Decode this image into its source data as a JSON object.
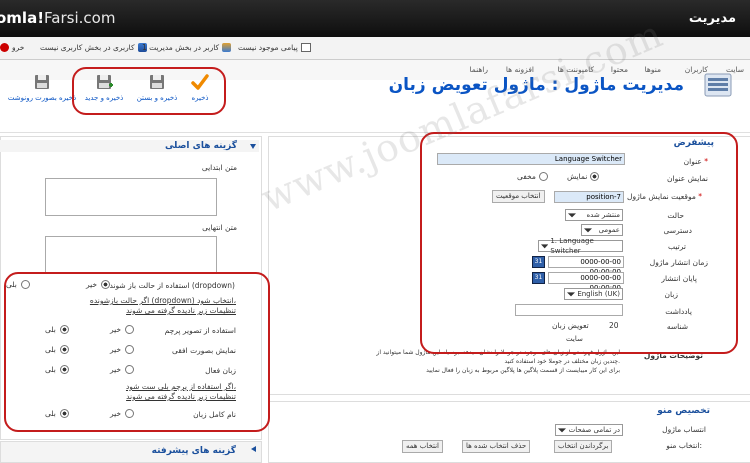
{
  "header": {
    "logo_a": "omla!",
    "logo_b": "Farsi.com",
    "title": "مدیریت"
  },
  "status": {
    "item1": "کاربری در بخش کاربری نیست",
    "item2": "1 کاربر در بخش مدیریت",
    "item3": "پیامی موجود نیست",
    "item4": "خرو"
  },
  "menu": [
    "سایت",
    "کاربران",
    "منوها",
    "محتوا",
    "کامپوننت ها",
    "افزونه ها",
    "راهنما"
  ],
  "toolbar": {
    "save": "ذخیره",
    "save_close": "ذخیره و بستن",
    "save_new": "ذخیره و جدید",
    "save_copy": "ذخیره بصورت رونوشت"
  },
  "page_title": "مدیریت ماژول : ماژول تعویض زبان",
  "details": {
    "title": "پیشفرض",
    "fields": {
      "title_label": "عنوان",
      "title_value": "Language Switcher",
      "show_title_label": "نمایش عنوان",
      "show": "نمایش",
      "hide": "مخفی",
      "position_label": "موقعیت نمایش ماژول",
      "position_value": "position-7",
      "position_btn": "انتخاب موقعیت",
      "status_label": "حالت",
      "status_value": "منتشر شده",
      "access_label": "دسترسی",
      "access_value": "عمومی",
      "order_label": "ترتیب",
      "order_value": "1. Language Switcher",
      "publish_up_label": "زمان انتشار ماژول",
      "publish_up_value": "0000-00-00 00:00:00",
      "publish_down_label": "پایان انتشار",
      "publish_down_value": "0000-00-00 00:00:00",
      "lang_label": "زبان",
      "lang_value": "English (UK)",
      "note_label": "یادداشت",
      "id_label": "شناسه",
      "id_value": "20",
      "type_value": "تعویض زبان",
      "site": "سایت"
    },
    "desc_label": "توضیحات ماژول",
    "desc_line1": "این ماژول فهرستی از زبان های موجود در جوملا را نشان میدهد. بوسیله این ماژول شما میتوانید از",
    "desc_line2": "چندین زبان مختلف در جوملا خود استفاده کنید.",
    "desc_line3": "برای این کار میبایست از قسمت پلاگین ها پلاگین مربوط به زبان را فعال نمایید"
  },
  "menu_assign": {
    "title": "تخصیص منو",
    "assign_label": "انتساب ماژول",
    "assign_value": "در تمامی صفحات",
    "select_label": "انتخاب منو:",
    "btn_invert": "برگرداندن انتخاب",
    "btn_clear": "حذف انتخاب شده ها",
    "btn_all": "انتخاب همه"
  },
  "basic": {
    "title": "گزینه های اصلی",
    "pre_text": "متن ابتدایی",
    "post_text": "متن انتهایی",
    "dropdown_label": "استفاده از حالت باز شونده (dropdown)",
    "no": "خیر",
    "yes": "بلی",
    "note1_line1": "اگر حالت بازشونده (dropdown) انتخاب شود،",
    "note1_line2": "تنظیمات زیر نادیده گرفته می شوند",
    "image_label": "استفاده از تصویر پرچم",
    "horizontal_label": "نمایش بصورت افقی",
    "active_label": "زبان فعال",
    "note2_line1": "اگر استفاده از پرچم بلی ست شود،",
    "note2_line2": "تنظیمات زیر نادیده گرفته می شوند",
    "fullname_label": "نام کامل زبان"
  },
  "advanced": {
    "title": "گزینه های پیشرفته"
  },
  "watermark": "www.joomlafarsi.com",
  "colors": {
    "accent": "#0b55c4",
    "highlight": "#c41c1c"
  }
}
